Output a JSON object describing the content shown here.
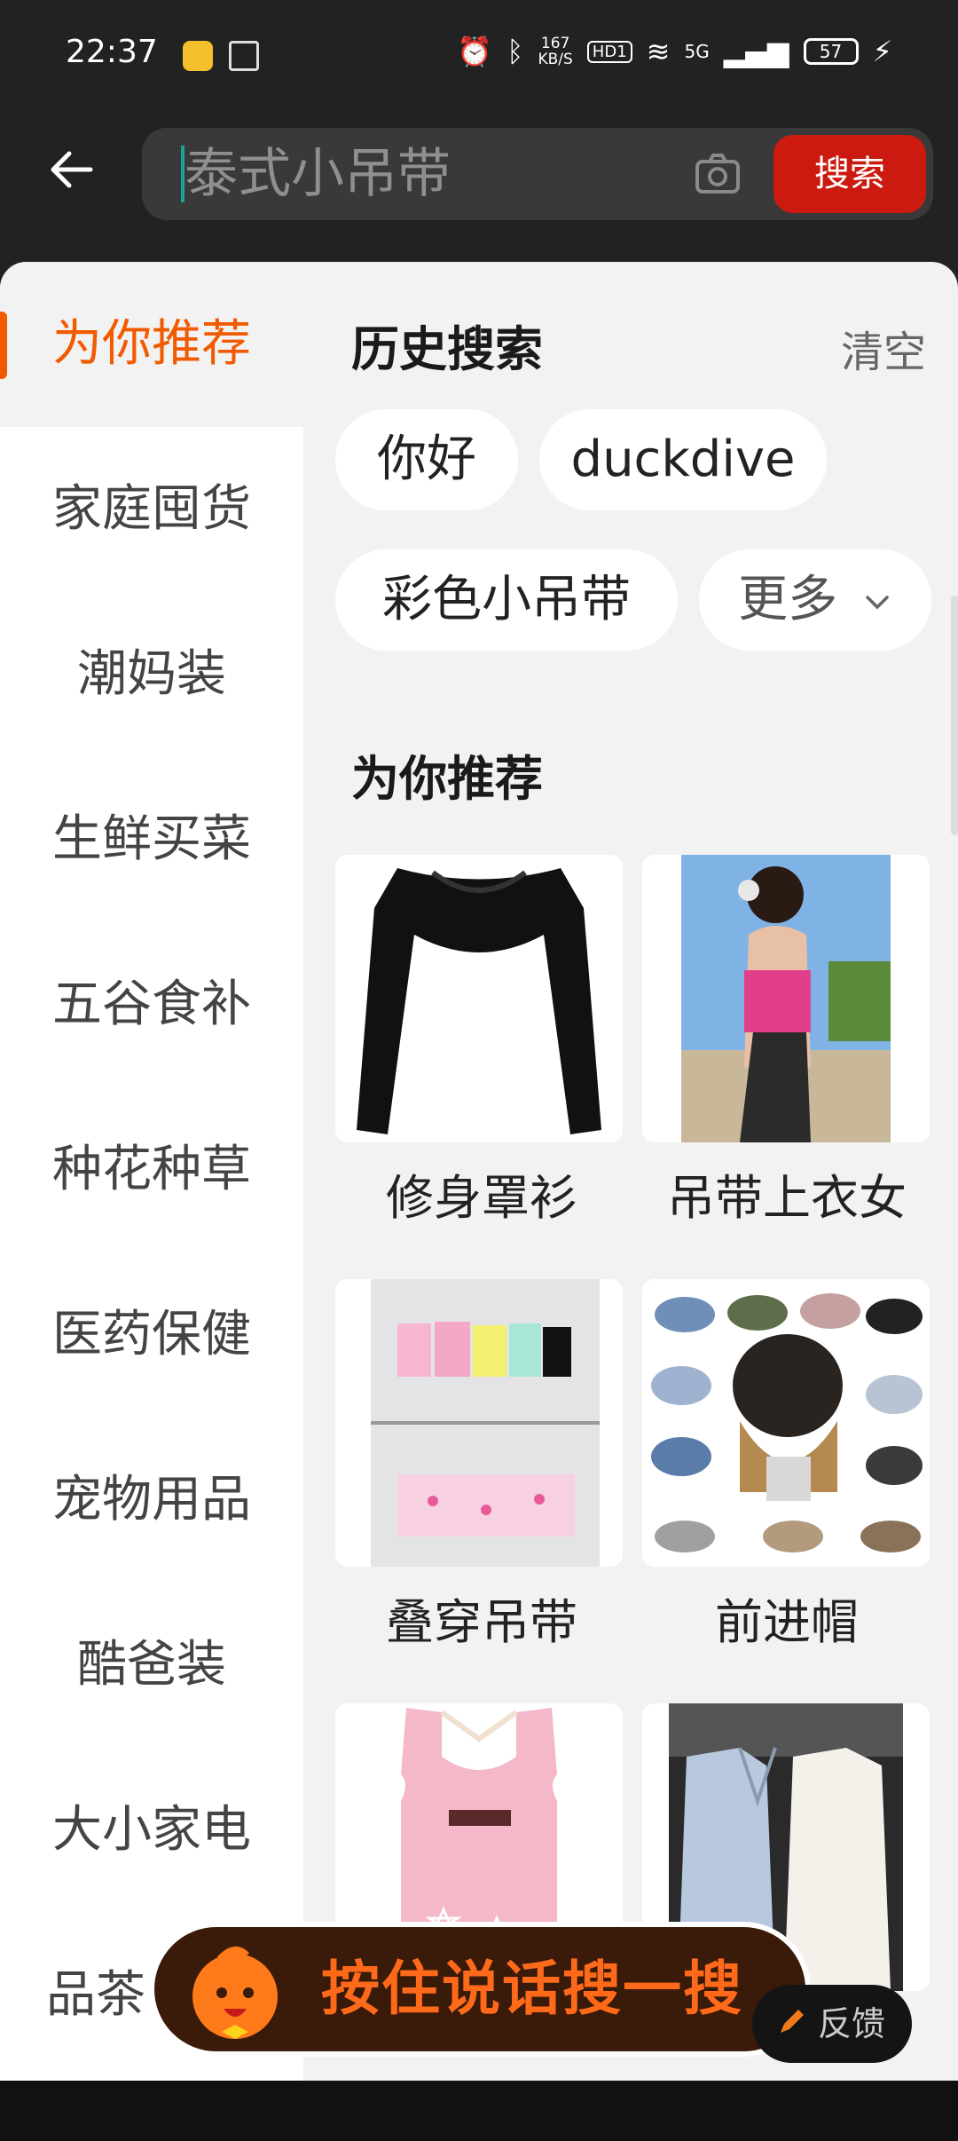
{
  "status_bar": {
    "time": "22:37",
    "speed_value": "167",
    "speed_unit": "KB/S",
    "hd_label": "HD1",
    "network": "5G",
    "battery": "57"
  },
  "search": {
    "value": "泰式小吊带",
    "button_label": "搜索"
  },
  "sidebar": {
    "items": [
      {
        "label": "为你推荐"
      },
      {
        "label": "家庭囤货"
      },
      {
        "label": "潮妈装"
      },
      {
        "label": "生鲜买菜"
      },
      {
        "label": "五谷食补"
      },
      {
        "label": "种花种草"
      },
      {
        "label": "医药保健"
      },
      {
        "label": "宠物用品"
      },
      {
        "label": "酷爸装"
      },
      {
        "label": "大小家电"
      },
      {
        "label": "品茶"
      }
    ]
  },
  "history": {
    "title": "历史搜索",
    "clear_label": "清空",
    "chips": [
      "你好",
      "duckdive",
      "彩色小吊带"
    ],
    "more_label": "更多"
  },
  "recommend": {
    "title": "为你推荐",
    "items": [
      {
        "label": "修身罩衫"
      },
      {
        "label": "吊带上衣女"
      },
      {
        "label": "叠穿吊带"
      },
      {
        "label": "前进帽"
      },
      {
        "label": ""
      },
      {
        "label": ""
      }
    ]
  },
  "voice_search": {
    "label": "按住说话搜一搜"
  },
  "feedback": {
    "label": "反馈"
  },
  "colors": {
    "accent": "#f15a00",
    "search_button": "#cc1a10",
    "header_bg": "#222222",
    "panel_bg": "#f2f2f2"
  }
}
